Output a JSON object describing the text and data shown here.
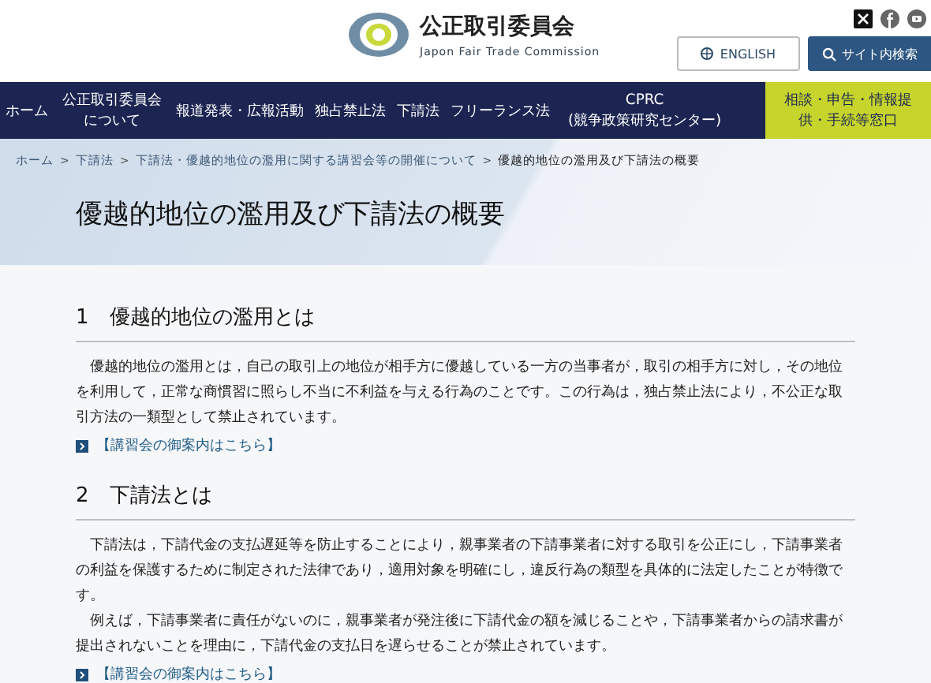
{
  "header": {
    "org_name": "公正取引委員会",
    "org_name_en": "Japon Fair Trade Commission",
    "english_button": "ENGLISH",
    "search_button": "サイト内検索"
  },
  "nav": [
    {
      "label": "ホーム",
      "kind": "normal"
    },
    {
      "label": "公正取引委員会について",
      "kind": "normal"
    },
    {
      "label": "報道発表・広報活動",
      "kind": "normal"
    },
    {
      "label": "独占禁止法",
      "kind": "normal"
    },
    {
      "label": "下請法",
      "kind": "normal"
    },
    {
      "label": "フリーランス法",
      "kind": "normal"
    },
    {
      "label": "CPRC (競争政策研究センター)",
      "kind": "normal"
    },
    {
      "label": "相談・申告・情報提供・手続等窓口",
      "kind": "highlight"
    }
  ],
  "breadcrumb": [
    {
      "label": "ホーム"
    },
    {
      "separator": ">",
      "label": "下請法"
    },
    {
      "separator": ">",
      "label": "下請法・優越的地位の濫用に関する講習会等の開催について"
    },
    {
      "separator": ">",
      "label": "優越的地位の濫用及び下請法の概要"
    }
  ],
  "page_title": "優越的地位の濫用及び下請法の概要",
  "sections": [
    {
      "heading": "1　優越的地位の濫用とは",
      "paragraphs": [
        "　優越的地位の濫用とは，自己の取引上の地位が相手方に優越している一方の当事者が，取引の相手方に対し，その地位を利用して，正常な商慣習に照らし不当に不利益を与える行為のことです。この行為は，独占禁止法により，不公正な取引方法の一類型として禁止されています。"
      ],
      "link": "【講習会の御案内はこちら】"
    },
    {
      "heading": "2　下請法とは",
      "paragraphs": [
        "　下請法は，下請代金の支払遅延等を防止することにより，親事業者の下請事業者に対する取引を公正にし，下請事業者の利益を保護するために制定された法律であり，適用対象を明確にし，違反行為の類型を具体的に法定したことが特徴です。",
        "　例えば，下請事業者に責任がないのに，親事業者が発注後に下請代金の額を減じることや，下請事業者からの請求書が提出されないことを理由に，下請代金の支払日を遅らせることが禁止されています。"
      ],
      "link": "【講習会の御案内はこちら】"
    }
  ]
}
